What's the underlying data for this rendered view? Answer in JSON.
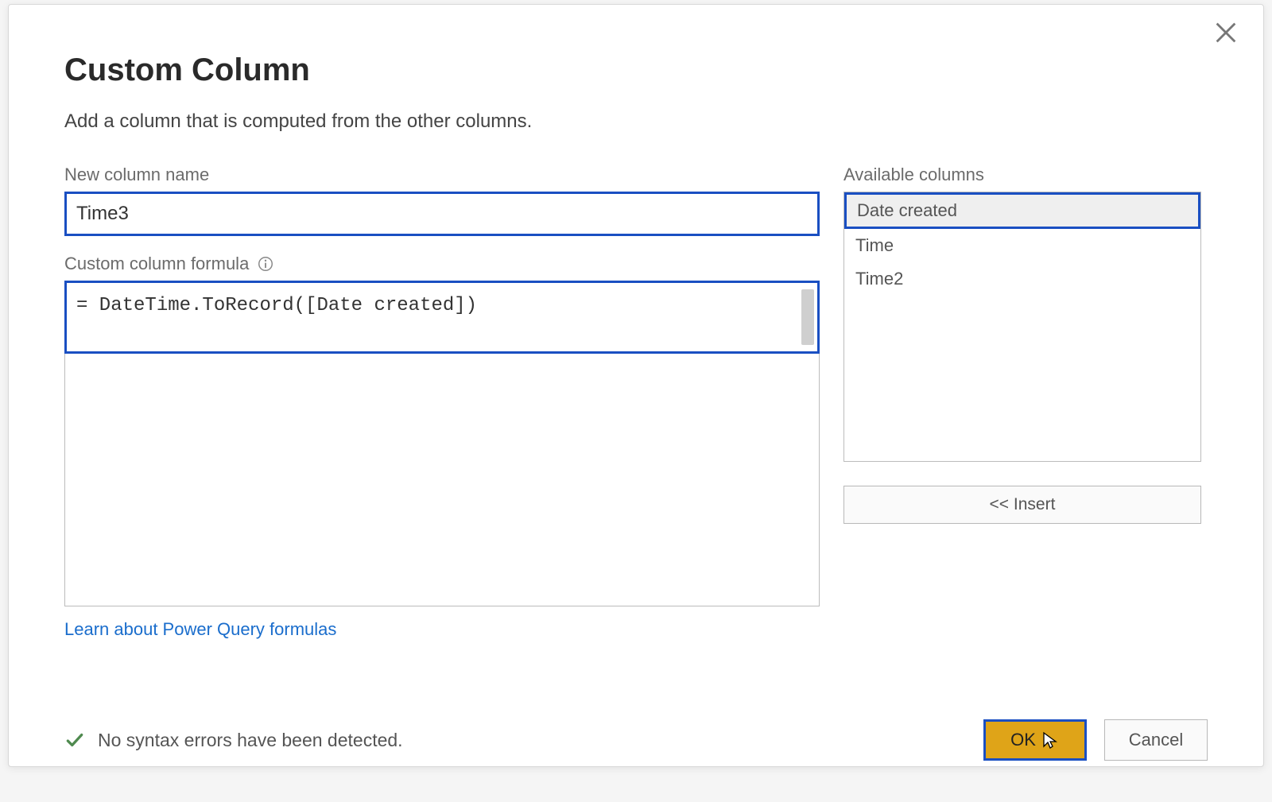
{
  "dialog": {
    "title": "Custom Column",
    "subtitle": "Add a column that is computed from the other columns.",
    "close_label": "Close"
  },
  "left": {
    "name_label": "New column name",
    "name_value": "Time3",
    "formula_label": "Custom column formula",
    "formula_value": "= DateTime.ToRecord([Date created])"
  },
  "right": {
    "available_label": "Available columns",
    "insert_label": "<< Insert",
    "columns": [
      {
        "label": "Date created",
        "selected": true
      },
      {
        "label": "Time",
        "selected": false
      },
      {
        "label": "Time2",
        "selected": false
      }
    ]
  },
  "link": {
    "learn_label": "Learn about Power Query formulas"
  },
  "status": {
    "message": "No syntax errors have been detected."
  },
  "buttons": {
    "ok": "OK",
    "cancel": "Cancel"
  }
}
